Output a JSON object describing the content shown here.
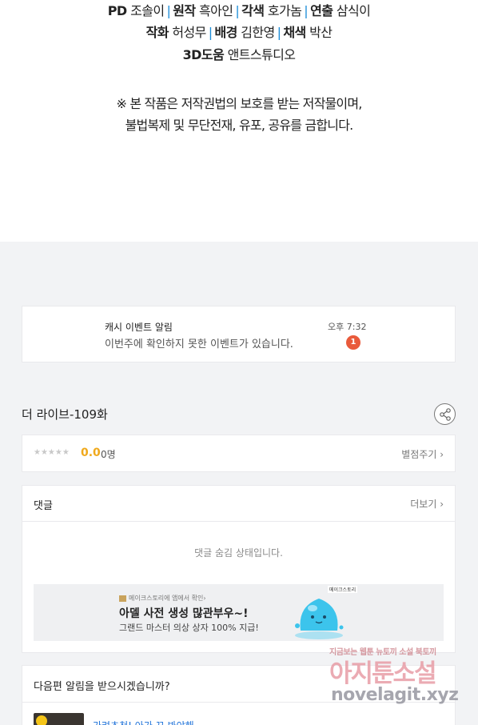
{
  "credits": {
    "line1": [
      {
        "role": "PD",
        "name": "조솔이"
      },
      {
        "role": "원작",
        "name": "흑아인"
      },
      {
        "role": "각색",
        "name": "호가놈"
      },
      {
        "role": "연출",
        "name": "삼식이"
      }
    ],
    "line2": [
      {
        "role": "작화",
        "name": "허성무"
      },
      {
        "role": "배경",
        "name": "김한영"
      },
      {
        "role": "채색",
        "name": "박산"
      }
    ],
    "line3": [
      {
        "role": "3D도움",
        "name": "앤트스튜디오"
      }
    ],
    "separator": "|",
    "notice_line1": "※ 본 작품은 저작권법의 보호를 받는 저작물이며,",
    "notice_line2": "불법복제 및 무단전재, 유포, 공유를 금합니다."
  },
  "event_notification": {
    "title": "캐시 이벤트 알림",
    "message": "이번주에 확인하지 못한 이벤트가 있습니다.",
    "time": "오후 7:32",
    "badge_count": "1"
  },
  "episode": {
    "title": "더 라이브-109화",
    "share_icon": "share-icon"
  },
  "rating": {
    "stars": "★★★★★",
    "score": "0.0",
    "count": "0명",
    "rate_link": "별점주기 ›"
  },
  "comments": {
    "title": "댓글",
    "more_link": "더보기 ›",
    "hidden_message": "댓글 숨김 상태입니다."
  },
  "ad": {
    "small_text": "메이크스토리에 앱에서 확인›",
    "main_text": "아델 사전 생성 많관부우~!",
    "sub_text": "그랜드 마스터 의상 상자 100% 지급!",
    "tag": "메이크스토리"
  },
  "next_episode": {
    "question": "다음편 알림을 받으시겠습니까?",
    "related_text": "가려초천! 아가 꼬 봐야해"
  },
  "watermark": {
    "top": "지금보는 웹툰 뉴토끼 소설 북토끼",
    "big": "아지툰소설",
    "url": "novelagit.xyz"
  },
  "colors": {
    "separator_blue": "#1a8cd8",
    "badge_red": "#e95a3b",
    "score_orange": "#f0a91c",
    "page_bg": "#f2f3f5"
  }
}
